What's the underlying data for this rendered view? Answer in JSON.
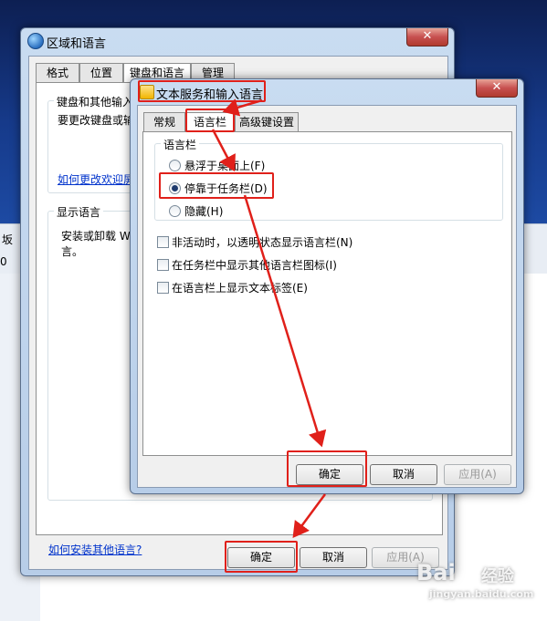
{
  "outer_window": {
    "title": "区域和语言",
    "close_glyph": "✕",
    "tabs": [
      "格式",
      "位置",
      "键盘和语言",
      "管理"
    ],
    "keyboard_group": {
      "title": "键盘和其他输入",
      "text": "要更改键盘或输",
      "link": "如何更改欢迎屏"
    },
    "display_group": {
      "title": "显示语言",
      "text_line1": "安装或卸载 W",
      "text_line2": "言。"
    },
    "bottom_link": "如何安装其他语言?",
    "buttons": {
      "ok": "确定",
      "cancel": "取消",
      "apply": "应用(A)"
    }
  },
  "inner_window": {
    "title": "文本服务和输入语言",
    "close_glyph": "✕",
    "tabs": [
      "常规",
      "语言栏",
      "高级键设置"
    ],
    "group_title": "语言栏",
    "radios": [
      {
        "label": "悬浮于桌面上(F)",
        "checked": false
      },
      {
        "label": "停靠于任务栏(D)",
        "checked": true
      },
      {
        "label": "隐藏(H)",
        "checked": false
      }
    ],
    "checkboxes": [
      {
        "label": "非活动时，以透明状态显示语言栏(N)",
        "checked": false
      },
      {
        "label": "在任务栏中显示其他语言栏图标(I)",
        "checked": false
      },
      {
        "label": "在语言栏上显示文本标签(E)",
        "checked": false
      }
    ],
    "buttons": {
      "ok": "确定",
      "cancel": "取消",
      "apply": "应用(A)"
    }
  },
  "background": {
    "partial_text_1": "坂",
    "partial_text_2": "0"
  },
  "watermark": {
    "logo": "Bai",
    "brand": "经验",
    "url": "jingyan.baidu.com"
  },
  "annotation_color": "#e0201a"
}
